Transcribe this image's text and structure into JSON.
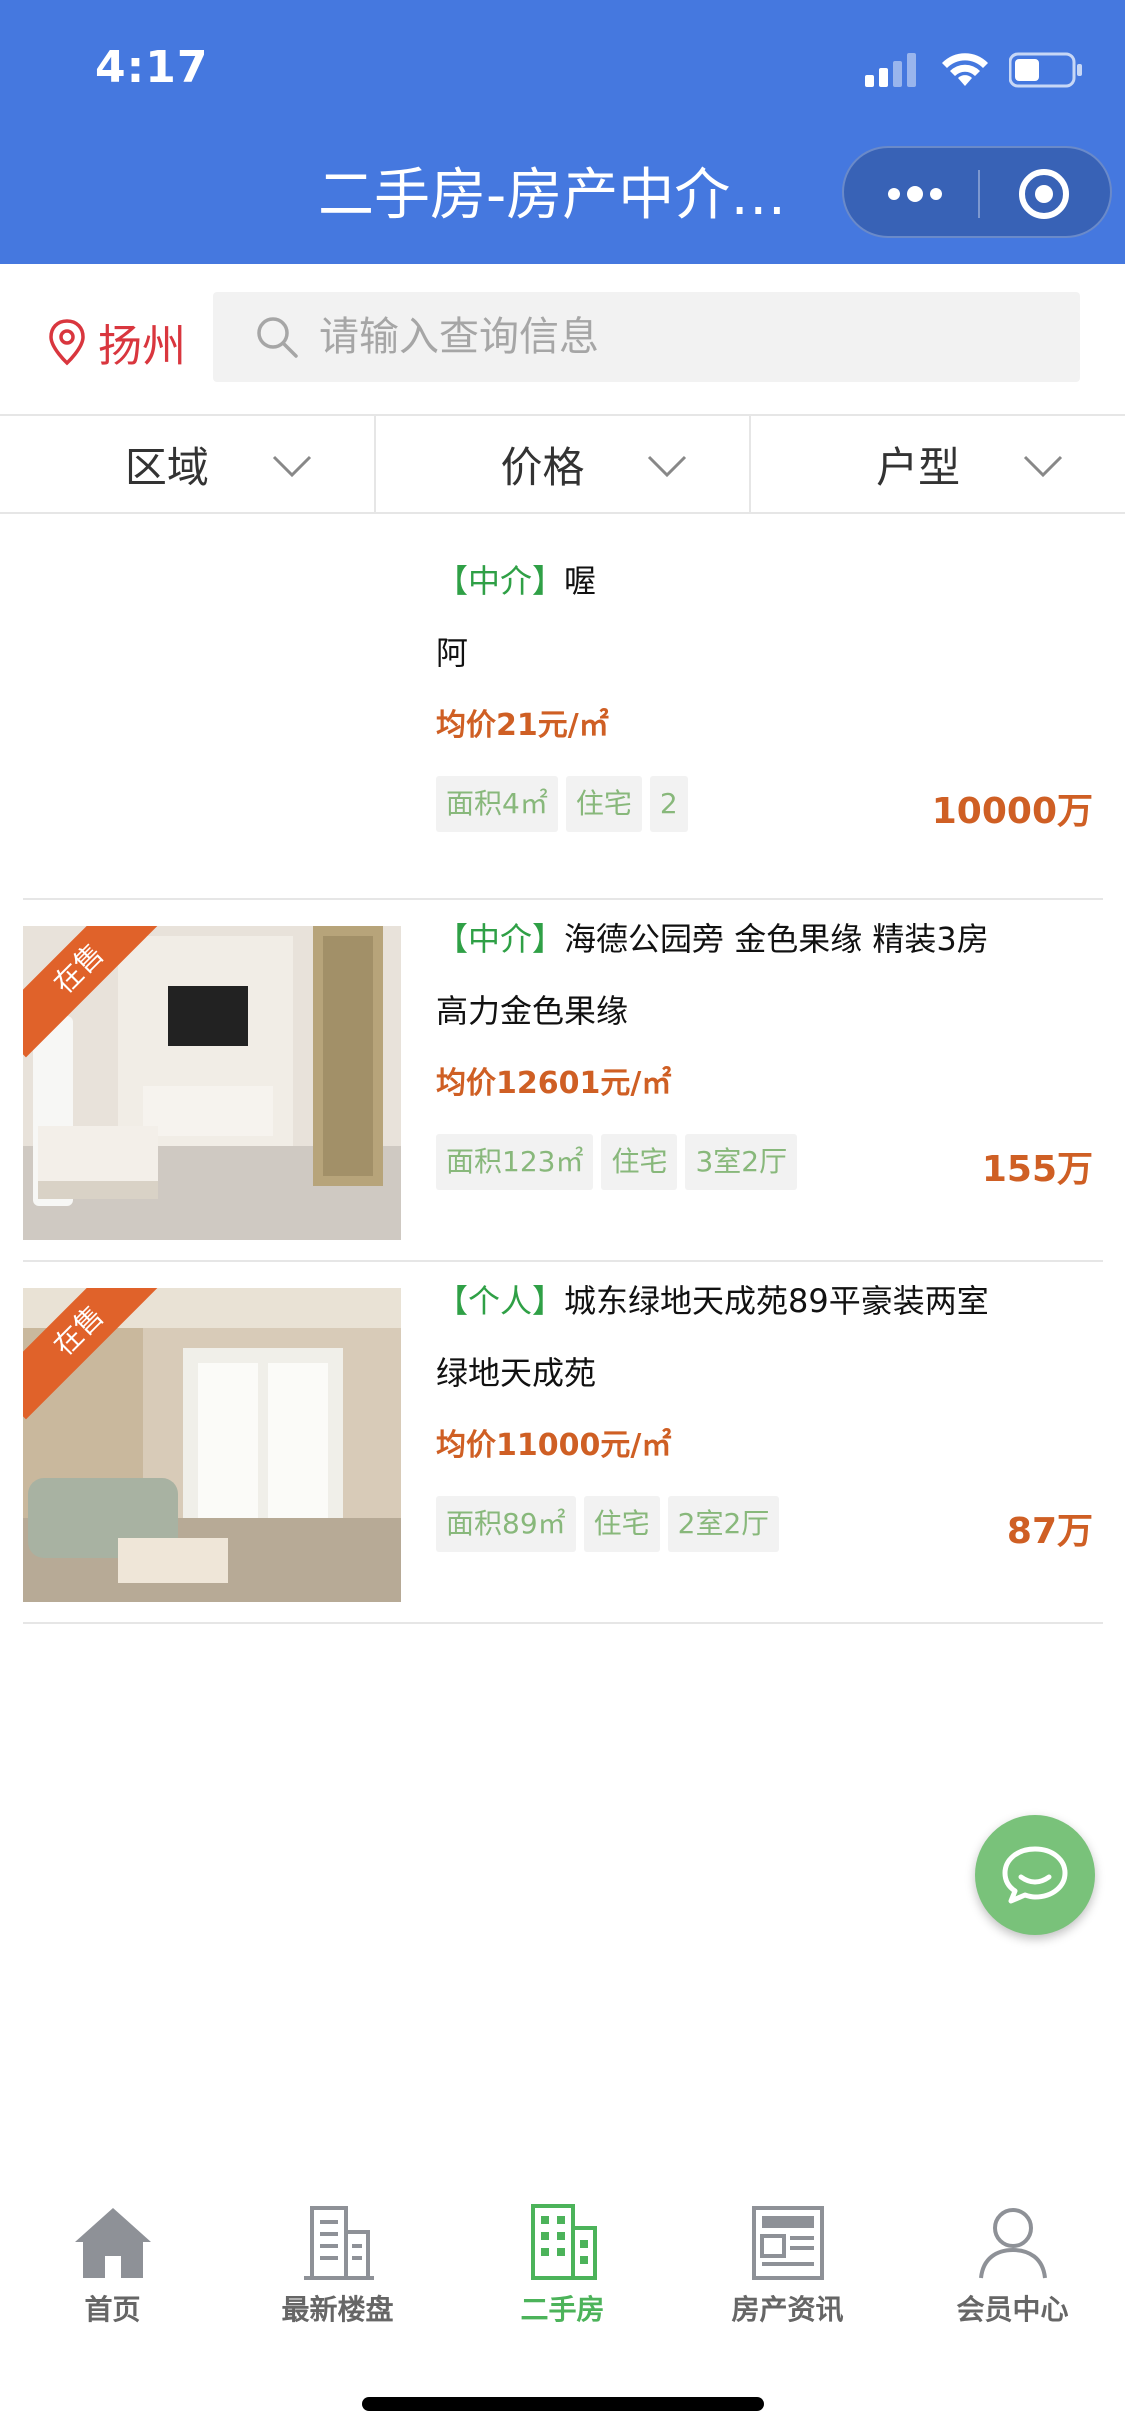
{
  "status_bar": {
    "time": "4:17",
    "icons": [
      "signal-icon",
      "wifi-icon",
      "battery-icon"
    ]
  },
  "header": {
    "title": "二手房-房产中介…"
  },
  "location": {
    "city": "扬州"
  },
  "search": {
    "placeholder": "请输入查询信息"
  },
  "filters": [
    {
      "label": "区域"
    },
    {
      "label": "价格"
    },
    {
      "label": "户型"
    }
  ],
  "listings": [
    {
      "type_tag": "【中介】",
      "title": "喔",
      "community": "阿",
      "avg_price": "均价21元/㎡",
      "chips": [
        "面积4㎡",
        "住宅",
        "2"
      ],
      "total_price": "10000万",
      "badge": "",
      "has_image": false
    },
    {
      "type_tag": "【中介】",
      "title": "海德公园旁 金色果缘 精装3房",
      "community": "高力金色果缘",
      "avg_price": "均价12601元/㎡",
      "chips": [
        "面积123㎡",
        "住宅",
        "3室2厅"
      ],
      "total_price": "155万",
      "badge": "在售",
      "has_image": true
    },
    {
      "type_tag": "【个人】",
      "title": "城东绿地天成苑89平豪装两室",
      "community": "绿地天成苑",
      "avg_price": "均价11000元/㎡",
      "chips": [
        "面积89㎡",
        "住宅",
        "2室2厅"
      ],
      "total_price": "87万",
      "badge": "在售",
      "has_image": true
    }
  ],
  "tabs": [
    {
      "label": "首页",
      "icon": "home-icon",
      "active": false
    },
    {
      "label": "最新楼盘",
      "icon": "building-icon",
      "active": false
    },
    {
      "label": "二手房",
      "icon": "apartment-icon",
      "active": true
    },
    {
      "label": "房产资讯",
      "icon": "news-icon",
      "active": false
    },
    {
      "label": "会员中心",
      "icon": "user-icon",
      "active": false
    }
  ],
  "colors": {
    "header_bg": "#4578df",
    "price": "#cf5f24",
    "tag_green": "#2fa046",
    "chip_text": "#88b87b",
    "badge": "#e0622a",
    "active_tab": "#4cb35a",
    "fab": "#79c27a",
    "city": "#d9363e"
  }
}
